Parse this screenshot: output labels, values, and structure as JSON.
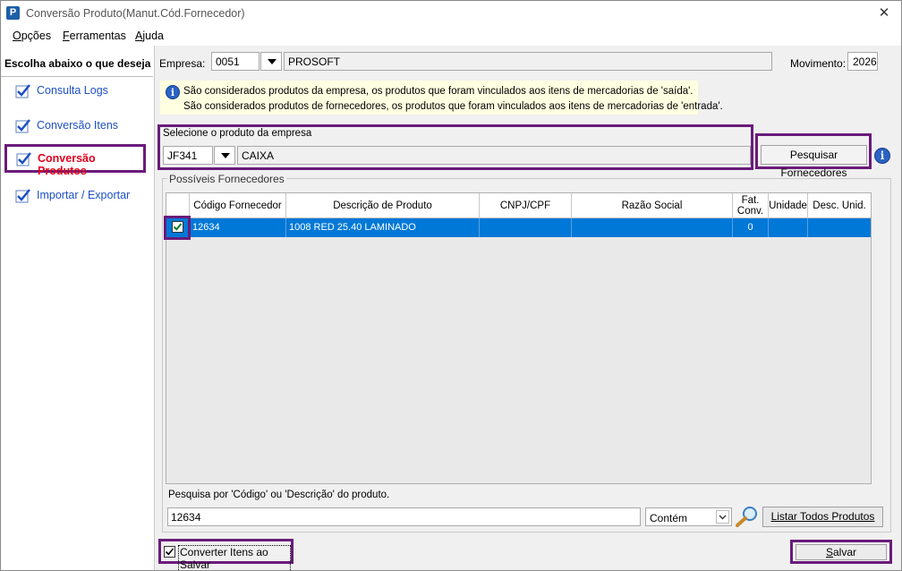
{
  "window": {
    "title": "Conversão Produto(Manut.Cód.Fornecedor)",
    "app_icon_letter": "P",
    "close_glyph": "✕"
  },
  "menu": {
    "items": [
      {
        "label_first": "O",
        "label_rest": "pções"
      },
      {
        "label_first": "F",
        "label_rest": "erramentas"
      },
      {
        "label_first": "A",
        "label_rest": "juda"
      }
    ]
  },
  "sidebar": {
    "header": "Escolha abaixo o que deseja",
    "items": [
      {
        "label": "Consulta Logs",
        "icon": "check-icon"
      },
      {
        "label": "Conversão Itens",
        "icon": "check-icon"
      },
      {
        "label": "Conversão Produtos",
        "icon": "check-icon",
        "active": true
      },
      {
        "label": "Importar / Exportar",
        "icon": "check-icon"
      }
    ]
  },
  "empresa": {
    "label": "Empresa:",
    "code": "0051",
    "name": "PROSOFT"
  },
  "movimento": {
    "label": "Movimento:",
    "value": "2026"
  },
  "info": {
    "icon": "info-icon",
    "line1": "São considerados produtos da empresa, os produtos que foram vinculados aos itens de mercadorias de 'saída'.",
    "line2": "São considerados produtos de fornecedores, os produtos que foram vinculados aos itens de mercadorias de 'entrada'."
  },
  "produto": {
    "group_label": "Selecione o produto da empresa",
    "code": "JF341",
    "description": "CAIXA"
  },
  "pesquisar_button": "Pesquisar Fornecedores",
  "fornecedores": {
    "legend": "Possíveis Fornecedores",
    "columns": [
      "Código Fornecedor",
      "Descrição de Produto",
      "CNPJ/CPF",
      "Razão Social",
      "Fat. Conv.",
      "Unidade",
      "Desc. Unid."
    ],
    "rows": [
      {
        "checked": true,
        "codigo": "12634",
        "descricao": "1008 RED 25.40 LAMINADO",
        "cnpj": "",
        "razao": "",
        "fat_conv": "0",
        "unidade": "",
        "desc_unid": ""
      }
    ]
  },
  "search": {
    "label": "Pesquisa por 'Código' ou 'Descrição' do produto.",
    "value": "12634",
    "mode": "Contém",
    "listar_button": "Listar Todos Produtos"
  },
  "footer": {
    "converter_label": "Converter Itens ao Salvar",
    "converter_checked": true,
    "salvar_first": "S",
    "salvar_rest": "alvar"
  },
  "colors": {
    "highlight_border": "#6a1b7a",
    "selection": "#0078d7",
    "active_sidebar_text": "#e3001b",
    "link_text": "#1d4fc4"
  }
}
